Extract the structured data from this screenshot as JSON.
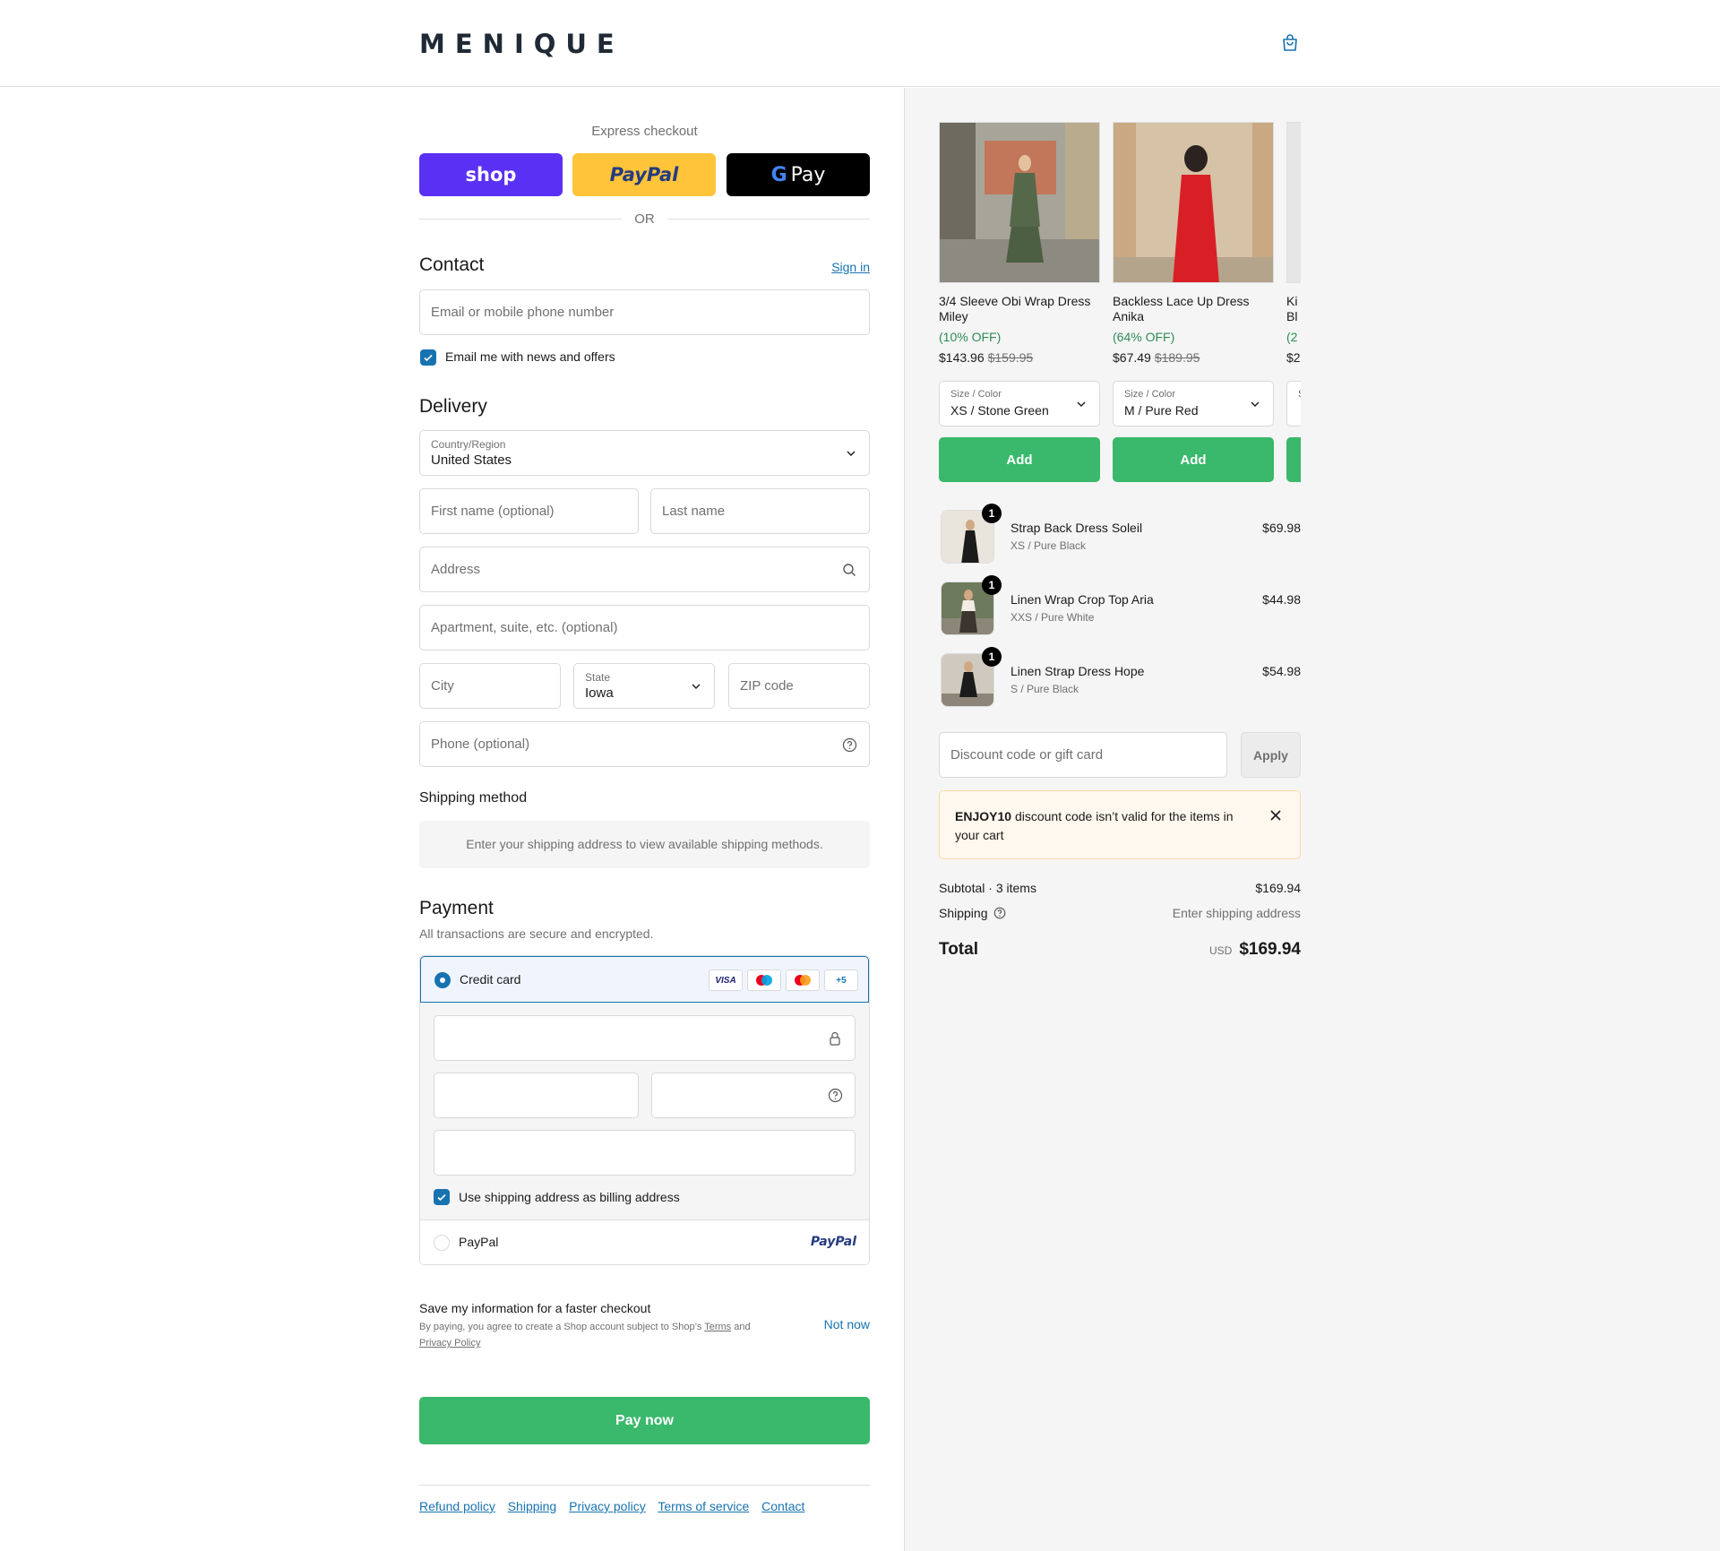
{
  "header": {
    "logo": "MENIQUE",
    "cart_icon": "shopping-bag-icon"
  },
  "express": {
    "label": "Express checkout",
    "shop_label": "shop",
    "paypal_label": "PayPal",
    "gpay_label": "Pay",
    "or_label": "OR"
  },
  "contact": {
    "title": "Contact",
    "sign_in": "Sign in",
    "email_placeholder": "Email or mobile phone number",
    "news_label": "Email me with news and offers"
  },
  "delivery": {
    "title": "Delivery",
    "country_label": "Country/Region",
    "country_value": "United States",
    "first_name_placeholder": "First name (optional)",
    "last_name_placeholder": "Last name",
    "address_placeholder": "Address",
    "apartment_placeholder": "Apartment, suite, etc. (optional)",
    "city_placeholder": "City",
    "state_label": "State",
    "state_value": "Iowa",
    "zip_placeholder": "ZIP code",
    "phone_placeholder": "Phone (optional)"
  },
  "shipping_method": {
    "title": "Shipping method",
    "message": "Enter your shipping address to view available shipping methods."
  },
  "payment": {
    "title": "Payment",
    "subtitle": "All transactions are secure and encrypted.",
    "credit_card_label": "Credit card",
    "card_brands": [
      "VISA",
      "maestro",
      "mastercard",
      "+5"
    ],
    "billing_label": "Use shipping address as billing address",
    "paypal_label": "PayPal",
    "paypal_logo": "PayPal"
  },
  "save_info": {
    "title": "Save my information for a faster checkout",
    "text": "By paying, you agree to create a Shop account subject to Shop’s",
    "terms": "Terms",
    "and": "and",
    "privacy": "Privacy Policy",
    "not_now": "Not now"
  },
  "pay_now": "Pay now",
  "footer": [
    "Refund policy",
    "Shipping",
    "Privacy policy",
    "Terms of service",
    "Contact"
  ],
  "recommendations": [
    {
      "name": "3/4 Sleeve Obi Wrap Dress Miley",
      "off": "(10% OFF)",
      "price": "$143.96",
      "compare": "$159.95",
      "sel_label": "Size / Color",
      "sel_value": "XS / Stone Green",
      "add": "Add"
    },
    {
      "name": "Backless Lace Up Dress Anika",
      "off": "(64% OFF)",
      "price": "$67.49",
      "compare": "$189.95",
      "sel_label": "Size / Color",
      "sel_value": "M / Pure Red",
      "add": "Add"
    },
    {
      "name": "Ki Bl",
      "off": "(2",
      "price": "$2",
      "compare": "",
      "sel_label": "S",
      "sel_value": "",
      "add": ""
    }
  ],
  "cart": [
    {
      "qty": "1",
      "name": "Strap Back Dress Soleil",
      "variant": "XS / Pure Black",
      "price": "$69.98"
    },
    {
      "qty": "1",
      "name": "Linen Wrap Crop Top Aria",
      "variant": "XXS / Pure White",
      "price": "$44.98"
    },
    {
      "qty": "1",
      "name": "Linen Strap Dress Hope",
      "variant": "S / Pure Black",
      "price": "$54.98"
    }
  ],
  "discount": {
    "placeholder": "Discount code or gift card",
    "apply": "Apply"
  },
  "notice": {
    "code": "ENJOY10",
    "text": "discount code isn’t valid for the items in your cart"
  },
  "summary": {
    "subtotal_label": "Subtotal · 3 items",
    "subtotal_value": "$169.94",
    "shipping_label": "Shipping",
    "shipping_value": "Enter shipping address",
    "total_label": "Total",
    "currency": "USD",
    "total_value": "$169.94"
  },
  "colors": {
    "accent": "#1773b0",
    "pay_green": "#3ab86b",
    "shop_purple": "#5a31f4",
    "paypal_yellow": "#ffc439"
  }
}
